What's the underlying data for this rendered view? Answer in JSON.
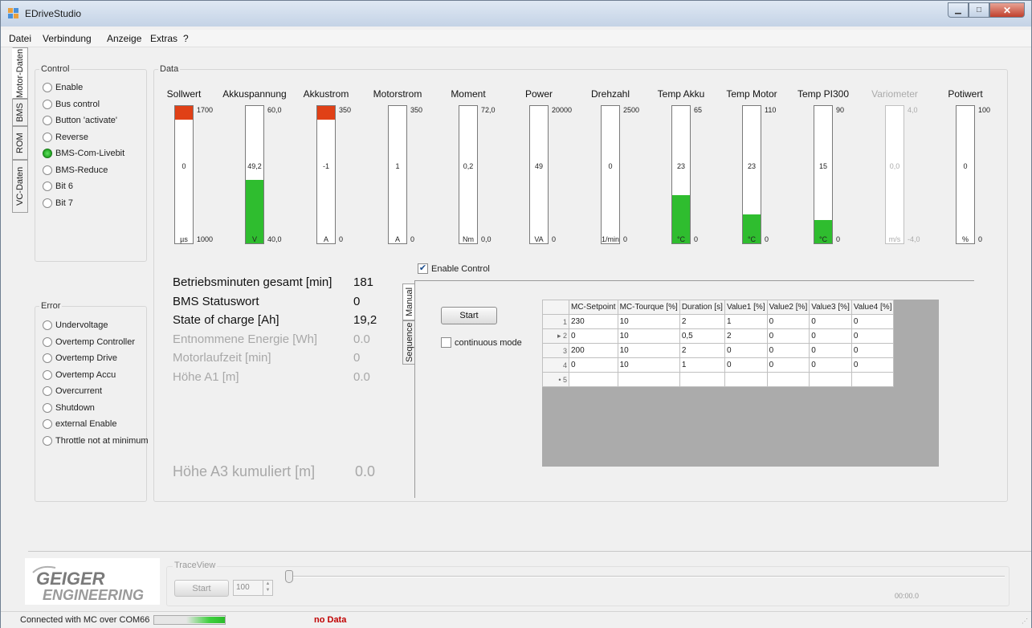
{
  "window": {
    "title": "EDriveStudio"
  },
  "menu": [
    "Datei",
    "Verbindung",
    "Anzeige",
    "Extras",
    "?"
  ],
  "vertical_tabs": [
    "Motor-Daten",
    "BMS",
    "ROM",
    "VC-Daten"
  ],
  "control": {
    "label": "Control",
    "items": [
      {
        "label": "Enable",
        "active": false
      },
      {
        "label": "Bus control",
        "active": false
      },
      {
        "label": "Button 'activate'",
        "active": false
      },
      {
        "label": "Reverse",
        "active": false
      },
      {
        "label": "BMS-Com-Livebit",
        "active": true
      },
      {
        "label": "BMS-Reduce",
        "active": false
      },
      {
        "label": "Bit 6",
        "active": false
      },
      {
        "label": "Bit 7",
        "active": false
      }
    ]
  },
  "error": {
    "label": "Error",
    "items": [
      "Undervoltage",
      "Overtemp Controller",
      "Overtemp Drive",
      "Overtemp Accu",
      "Overcurrent",
      "Shutdown",
      "external Enable",
      "Throttle not at minimum"
    ]
  },
  "data_label": "Data",
  "meters": [
    {
      "title": "Sollwert",
      "max": "1700",
      "min": "1000",
      "value": "0",
      "unit": "µs",
      "fill_fraction": 0.06,
      "color": "#e04016",
      "disabled": false
    },
    {
      "title": "Akkuspannung",
      "max": "60,0",
      "min": "40,0",
      "value": "49,2",
      "unit": "V",
      "fill_fraction": 0.46,
      "color": "#2fbd2f",
      "disabled": false
    },
    {
      "title": "Akkustrom",
      "max": "350",
      "min": "0",
      "value": "-1",
      "unit": "A",
      "fill_fraction": 0.06,
      "color": "#e04016",
      "disabled": false
    },
    {
      "title": "Motorstrom",
      "max": "350",
      "min": "0",
      "value": "1",
      "unit": "A",
      "fill_fraction": 0,
      "color": "#2fbd2f",
      "disabled": false
    },
    {
      "title": "Moment",
      "max": "72,0",
      "min": "0,0",
      "value": "0,2",
      "unit": "Nm",
      "fill_fraction": 0,
      "color": "#2fbd2f",
      "disabled": false
    },
    {
      "title": "Power",
      "max": "20000",
      "min": "0",
      "value": "49",
      "unit": "VA",
      "fill_fraction": 0,
      "color": "#2fbd2f",
      "disabled": false
    },
    {
      "title": "Drehzahl",
      "max": "2500",
      "min": "0",
      "value": "0",
      "unit": "1/min",
      "fill_fraction": 0,
      "color": "#2fbd2f",
      "disabled": false
    },
    {
      "title": "Temp Akku",
      "max": "65",
      "min": "0",
      "value": "23",
      "unit": "°C",
      "fill_fraction": 0.35,
      "color": "#2fbd2f",
      "disabled": false
    },
    {
      "title": "Temp Motor",
      "max": "110",
      "min": "0",
      "value": "23",
      "unit": "°C",
      "fill_fraction": 0.21,
      "color": "#2fbd2f",
      "disabled": false
    },
    {
      "title": "Temp PI300",
      "max": "90",
      "min": "0",
      "value": "15",
      "unit": "°C",
      "fill_fraction": 0.17,
      "color": "#2fbd2f",
      "disabled": false
    },
    {
      "title": "Variometer",
      "max": "4,0",
      "min": "-4,0",
      "value": "0,0",
      "unit": "m/s",
      "fill_fraction": 0,
      "color": "#2fbd2f",
      "disabled": true
    },
    {
      "title": "Potiwert",
      "max": "100",
      "min": "0",
      "value": "0",
      "unit": "%",
      "fill_fraction": 0,
      "color": "#2fbd2f",
      "disabled": false
    }
  ],
  "stats": [
    {
      "label": "Betriebsminuten gesamt [min]",
      "value": "181",
      "disabled": false
    },
    {
      "label": "BMS Statuswort",
      "value": "0",
      "disabled": false
    },
    {
      "label": "State of charge [Ah]",
      "value": "19,2",
      "disabled": false
    },
    {
      "label": "Entnommene Energie [Wh]",
      "value": "0.0",
      "disabled": true
    },
    {
      "label": "Motorlaufzeit [min]",
      "value": "0",
      "disabled": true
    },
    {
      "label": "Höhe A1 [m]",
      "value": "0.0",
      "disabled": true
    }
  ],
  "stat_big": {
    "label": "Höhe A3 kumuliert [m]",
    "value": "0.0"
  },
  "enable_control": {
    "label": "Enable Control",
    "checked": true
  },
  "sequence": {
    "tabs": [
      "Manual",
      "Sequence"
    ],
    "start_label": "Start",
    "continuous_label": "continuous mode",
    "columns": [
      "MC-Setpoint",
      "MC-Tourque [%]",
      "Duration [s]",
      "Value1 [%]",
      "Value2 [%]",
      "Value3 [%]",
      "Value4 [%]"
    ],
    "rows": [
      {
        "idx": "1",
        "cells": [
          "230",
          "10",
          "2",
          "1",
          "0",
          "0",
          "0"
        ]
      },
      {
        "idx": "▸ 2",
        "cells": [
          "0",
          "10",
          "0,5",
          "2",
          "0",
          "0",
          "0"
        ]
      },
      {
        "idx": "3",
        "cells": [
          "200",
          "10",
          "2",
          "0",
          "0",
          "0",
          "0"
        ]
      },
      {
        "idx": "4",
        "cells": [
          "0",
          "10",
          "1",
          "0",
          "0",
          "0",
          "0"
        ]
      },
      {
        "idx": "• 5",
        "cells": [
          "",
          "",
          "",
          "",
          "",
          "",
          ""
        ]
      }
    ]
  },
  "logo": {
    "line1": "GEIGER",
    "line2": "ENGINEERING"
  },
  "traceview": {
    "label": "TraceView",
    "start_label": "Start",
    "count": "100",
    "time": "00:00.0"
  },
  "status": {
    "connection": "Connected with MC over COM66",
    "data": "no Data",
    "data_color": "#c00000"
  }
}
